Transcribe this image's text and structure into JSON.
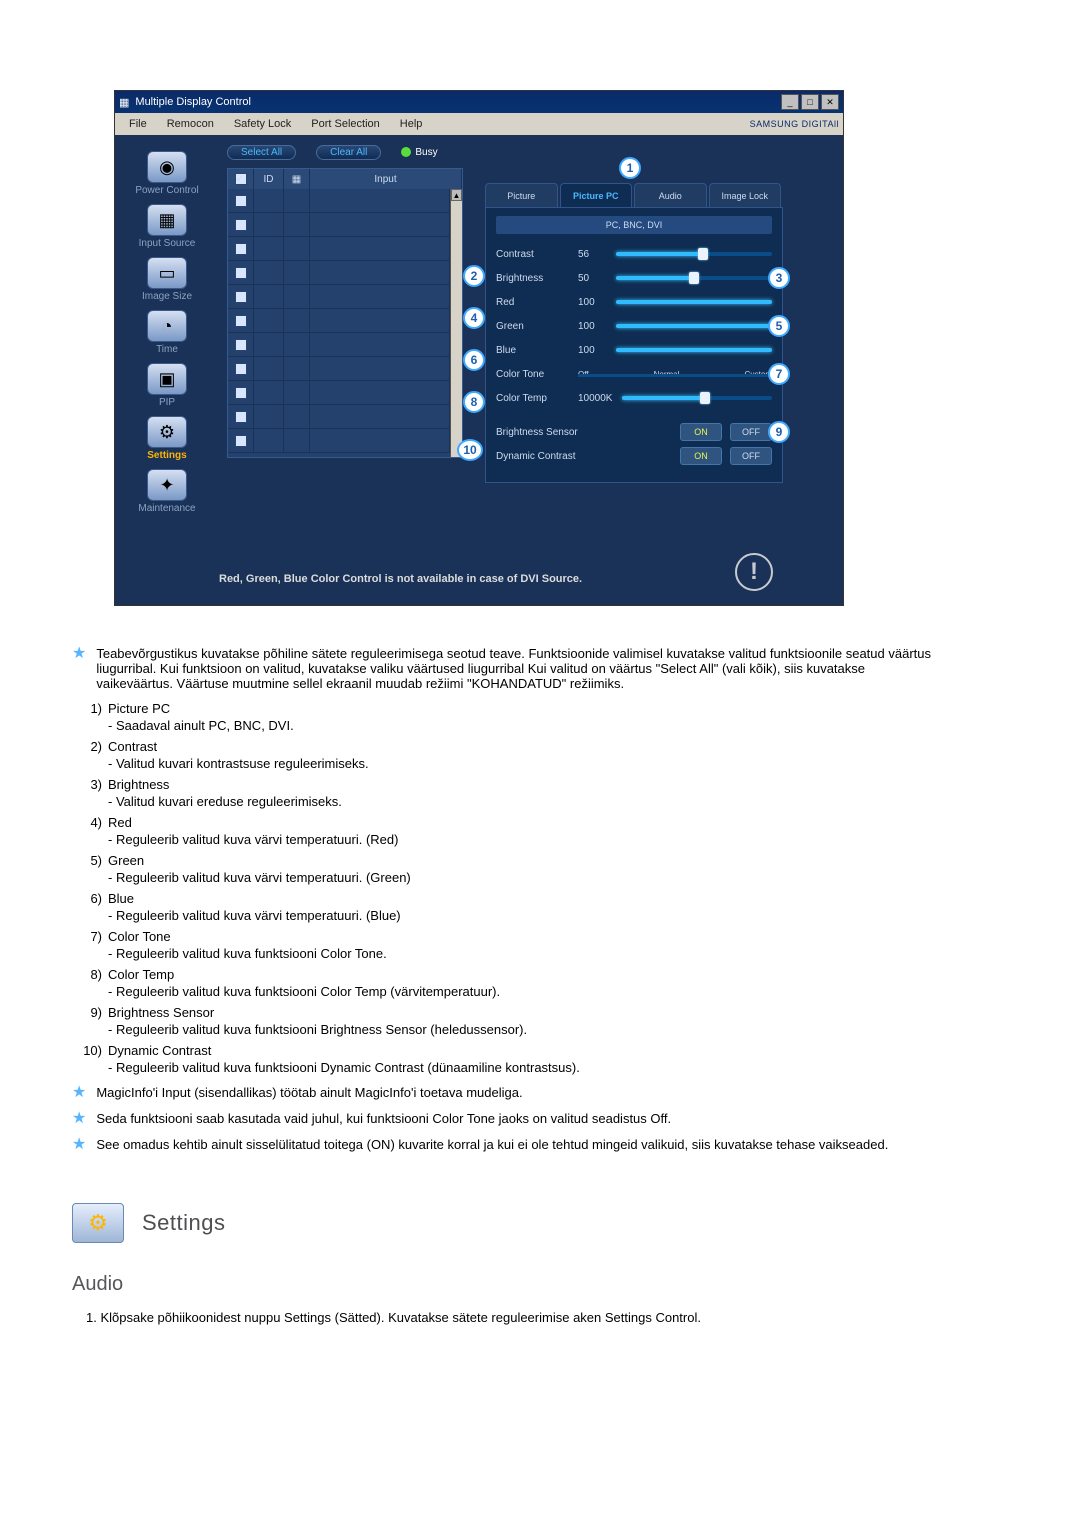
{
  "window": {
    "title": "Multiple Display Control",
    "menus": [
      "File",
      "Remocon",
      "Safety Lock",
      "Port Selection",
      "Help"
    ],
    "brand": "SAMSUNG DIGITAll"
  },
  "nav": {
    "items": [
      {
        "label": "Power Control",
        "glyph": "◉"
      },
      {
        "label": "Input Source",
        "glyph": "▦"
      },
      {
        "label": "Image Size",
        "glyph": "▭"
      },
      {
        "label": "Time",
        "glyph": "◔"
      },
      {
        "label": "PIP",
        "glyph": "▣"
      },
      {
        "label": "Settings",
        "glyph": "⚙"
      },
      {
        "label": "Maintenance",
        "glyph": "✦"
      }
    ],
    "active_index": 5
  },
  "toolbar": {
    "select_all": "Select All",
    "clear_all": "Clear All",
    "busy": "Busy"
  },
  "list": {
    "columns": {
      "id": "ID",
      "input": "Input"
    },
    "rows": [
      {
        "checked": true
      },
      {
        "checked": false
      },
      {
        "checked": false
      },
      {
        "checked": false
      },
      {
        "checked": false
      },
      {
        "checked": false
      },
      {
        "checked": false
      },
      {
        "checked": false
      },
      {
        "checked": false
      },
      {
        "checked": false
      },
      {
        "checked": false
      }
    ]
  },
  "panel": {
    "tabs": [
      "Picture",
      "Picture PC",
      "Audio",
      "Image Lock"
    ],
    "active_tab": 1,
    "source_bar": "PC, BNC, DVI",
    "rows": {
      "contrast": {
        "label": "Contrast",
        "value": 56
      },
      "brightness": {
        "label": "Brightness",
        "value": 50
      },
      "red": {
        "label": "Red",
        "value": 100
      },
      "green": {
        "label": "Green",
        "value": 100
      },
      "blue": {
        "label": "Blue",
        "value": 100
      },
      "color_tone": {
        "label": "Color Tone",
        "options": [
          "Off",
          "Normal",
          "Custom"
        ]
      },
      "color_temp": {
        "label": "Color Temp",
        "value": "10000K"
      },
      "brightness_sensor": {
        "label": "Brightness Sensor",
        "on": "ON",
        "off": "OFF"
      },
      "dynamic_contrast": {
        "label": "Dynamic Contrast",
        "on": "ON",
        "off": "OFF"
      }
    },
    "badge_positions": [
      1,
      2,
      3,
      4,
      5,
      6,
      7,
      8,
      9,
      10
    ],
    "note": "Red, Green, Blue Color Control is not available in case of DVI Source."
  },
  "doc": {
    "intro": "Teabevõrgustikus kuvatakse põhiline sätete reguleerimisega seotud teave. Funktsioonide valimisel kuvatakse valitud funktsioonile seatud väärtus liugurribal. Kui funktsioon on valitud, kuvatakse valiku väärtused liugurribal Kui valitud on väärtus \"Select All\" (vali kõik), siis kuvatakse vaikeväärtus. Väärtuse muutmine sellel ekraanil muudab režiimi \"KOHANDATUD\" režiimiks.",
    "items": [
      {
        "n": "1)",
        "t": "Picture PC",
        "d": "Saadaval ainult PC, BNC, DVI."
      },
      {
        "n": "2)",
        "t": "Contrast",
        "d": "Valitud kuvari kontrastsuse reguleerimiseks."
      },
      {
        "n": "3)",
        "t": "Brightness",
        "d": "Valitud kuvari ereduse reguleerimiseks."
      },
      {
        "n": "4)",
        "t": "Red",
        "d": "Reguleerib valitud kuva värvi temperatuuri. (Red)"
      },
      {
        "n": "5)",
        "t": "Green",
        "d": "Reguleerib valitud kuva värvi temperatuuri. (Green)"
      },
      {
        "n": "6)",
        "t": "Blue",
        "d": "Reguleerib valitud kuva värvi temperatuuri. (Blue)"
      },
      {
        "n": "7)",
        "t": "Color Tone",
        "d": "Reguleerib valitud kuva funktsiooni Color Tone."
      },
      {
        "n": "8)",
        "t": "Color Temp",
        "d": "Reguleerib valitud kuva funktsiooni Color Temp (värvitemperatuur)."
      },
      {
        "n": "9)",
        "t": "Brightness Sensor",
        "d": "Reguleerib valitud kuva funktsiooni Brightness Sensor (heledussensor)."
      },
      {
        "n": "10)",
        "t": "Dynamic Contrast",
        "d": "Reguleerib valitud kuva funktsiooni Dynamic Contrast (dünaamiline kontrastsus)."
      }
    ],
    "stars": [
      "MagicInfo'i Input (sisendallikas) töötab ainult MagicInfo'i toetava mudeliga.",
      "Seda funktsiooni saab kasutada vaid juhul, kui funktsiooni Color Tone jaoks on valitud seadistus Off.",
      "See omadus kehtib ainult sisselülitatud toitega (ON) kuvarite korral ja kui ei ole tehtud mingeid valikuid, siis kuvatakse tehase vaikseaded."
    ],
    "section_title": "Settings",
    "sub_title": "Audio",
    "step1": "1.  Klõpsake põhiikoonidest nuppu Settings (Sätted). Kuvatakse sätete reguleerimise aken Settings Control."
  }
}
